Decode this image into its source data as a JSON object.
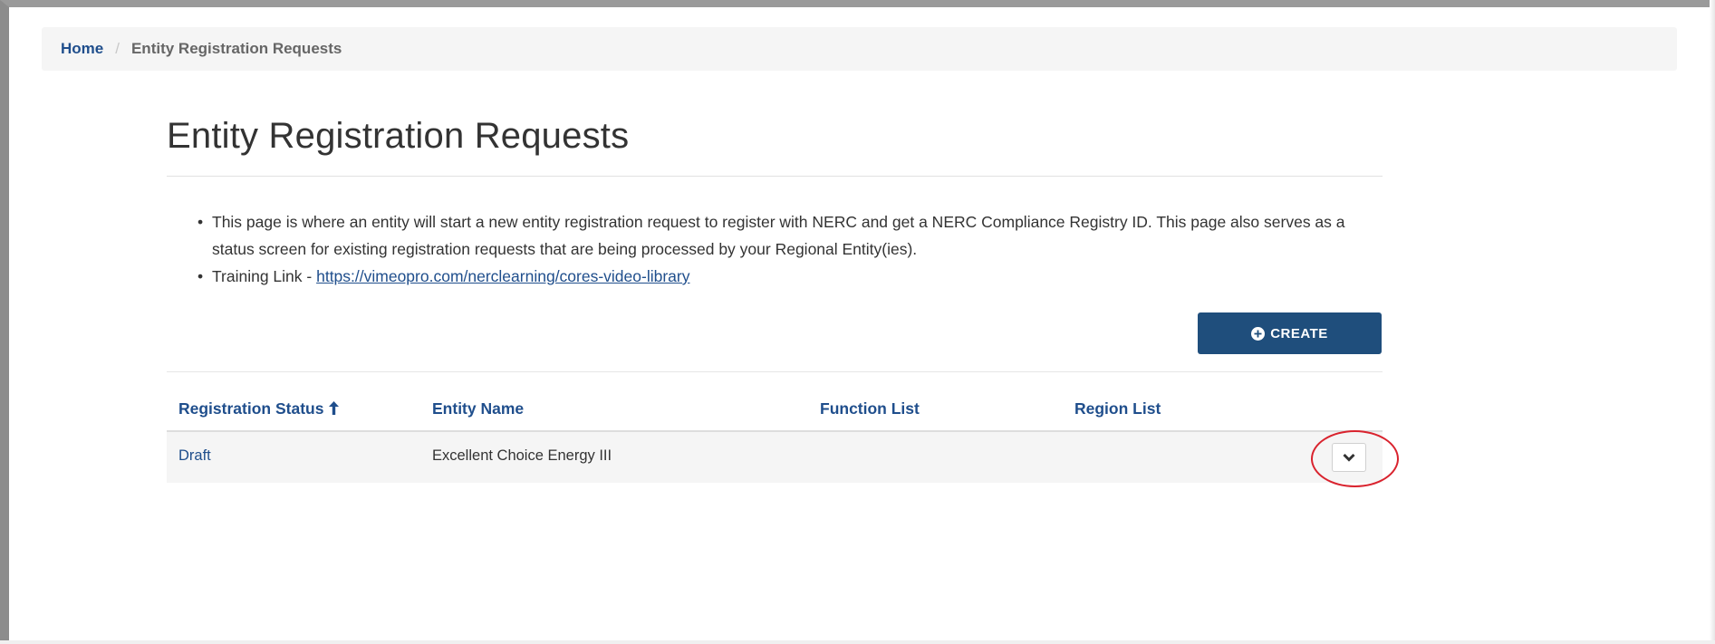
{
  "breadcrumb": {
    "home": "Home",
    "separator": "/",
    "current": "Entity Registration Requests"
  },
  "page": {
    "title": "Entity Registration Requests"
  },
  "info": {
    "bullet": "•",
    "line1": "This page is where an entity will start a new entity registration request to register with NERC and get a NERC Compliance Registry ID. This page also serves as a status screen for existing registration requests that are being processed by your Regional Entity(ies).",
    "training_prefix": "Training Link - ",
    "training_link": "https://vimeopro.com/nerclearning/cores-video-library"
  },
  "toolbar": {
    "create_label": "CREATE",
    "create_icon": "plus-circle-icon"
  },
  "table": {
    "columns": {
      "status": "Registration Status",
      "name": "Entity Name",
      "functions": "Function List",
      "regions": "Region List"
    },
    "sort_icon": "arrow-up-icon",
    "rows": [
      {
        "status": "Draft",
        "name": "Excellent Choice Energy III",
        "functions": "",
        "regions": ""
      }
    ],
    "row_action_icon": "chevron-down-icon"
  },
  "colors": {
    "primary": "#1f4e7c",
    "link": "#1f4e8c",
    "annotation": "#d9232e"
  }
}
